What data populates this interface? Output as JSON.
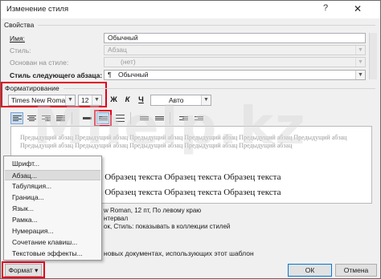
{
  "window": {
    "title": "Изменение стиля",
    "help_glyph": "?",
    "close_glyph": "✕"
  },
  "properties": {
    "section_label": "Свойства",
    "name_label": "Имя:",
    "name_value": "Обычный",
    "style_type_label": "Стиль:",
    "style_type_value": "Абзац",
    "based_on_label": "Основан на стиле:",
    "based_on_value": "(нет)",
    "next_style_label": "Стиль следующего абзаца:",
    "next_style_value": "Обычный",
    "next_style_icon": "¶"
  },
  "formatting": {
    "section_label": "Форматирование",
    "font": "Times New Roman",
    "size": "12",
    "bold": "Ж",
    "italic": "К",
    "underline": "Ч",
    "color": "Авто"
  },
  "preview": {
    "previous_paragraph": "Предыдущий абзац Предыдущий абзац Предыдущий абзац Предыдущий абзац Предыдущий абзац Предыдущий абзац Предыдущий абзац Предыдущий абзац Предыдущий абзац Предыдущий абзац Предыдущий абзац",
    "sample_line_1": "текста Образец текста Образец текста Образец текста",
    "sample_line_2": "текста Образец текста Образец текста Образец текста"
  },
  "description": {
    "line1": "w Roman, 12 пт, По левому краю",
    "line2": "нтервал",
    "line3": "ок, Стиль: показывать в коллекции стилей"
  },
  "options": {
    "only_this_doc_text": "новых документах, использующих этот шаблон"
  },
  "format_menu": {
    "items": [
      "Шрифт...",
      "Абзац...",
      "Табуляция...",
      "Граница...",
      "Язык...",
      "Рамка...",
      "Нумерация...",
      "Сочетание клавиш...",
      "Текстовые эффекты..."
    ]
  },
  "buttons": {
    "format": "Формат",
    "format_arrow": "▾",
    "ok": "ОК",
    "cancel": "Отмена"
  },
  "watermark": "Mhelp.kz",
  "colors": {
    "highlight_red": "#e0001b",
    "active_button": "#c8def3",
    "accent_blue": "#0078d7"
  }
}
